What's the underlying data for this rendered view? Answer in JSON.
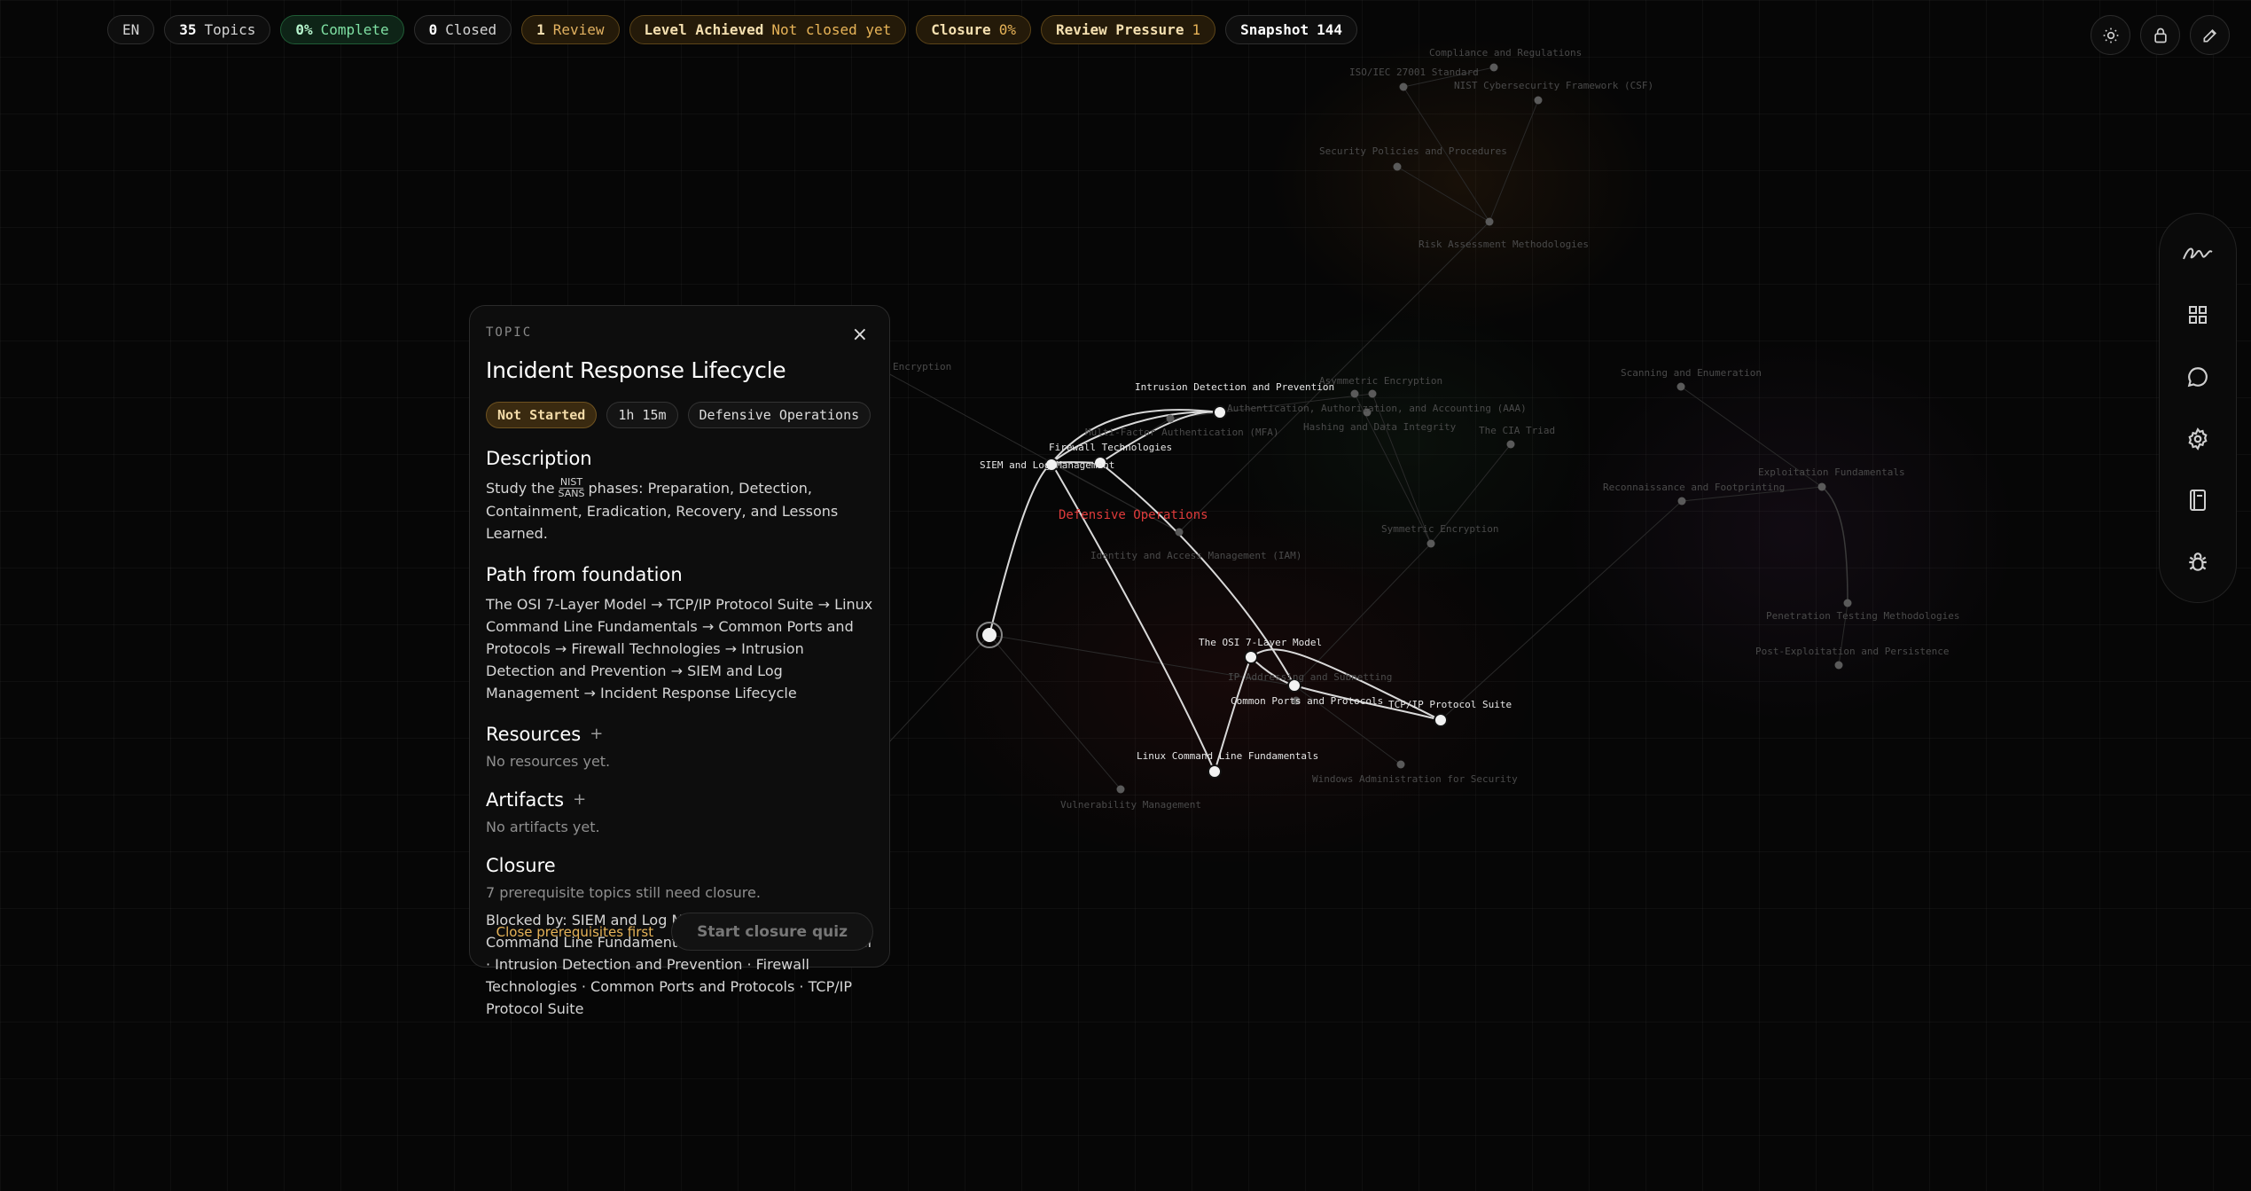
{
  "topbar": {
    "language": "EN",
    "topics_count": "35",
    "topics_label": "Topics",
    "complete_value": "0%",
    "complete_label": "Complete",
    "closed_count": "0",
    "closed_label": "Closed",
    "review_count": "1",
    "review_label": "Review",
    "level_label": "Level Achieved",
    "level_value": "Not closed yet",
    "closure_label": "Closure",
    "closure_value": "0%",
    "pressure_label": "Review Pressure",
    "pressure_value": "1",
    "snapshot_label": "Snapshot",
    "snapshot_value": "144"
  },
  "toolbar_icons": [
    "sun-icon",
    "lock-icon",
    "pencil-icon"
  ],
  "rail_icons": [
    "signature-icon",
    "grid-icon",
    "chat-icon",
    "gear-icon",
    "book-icon",
    "bug-icon"
  ],
  "panel": {
    "eyebrow": "TOPIC",
    "close_glyph": "×",
    "title": "Incident Response Lifecycle",
    "status": "Not Started",
    "duration": "1h 15m",
    "category": "Defensive Operations",
    "description_heading": "Description",
    "description_prefix": "Study the",
    "description_stack_top": "NIST",
    "description_stack_bottom": "SANS",
    "description_suffix": "phases: Preparation, Detection, Containment, Eradication, Recovery, and Lessons Learned.",
    "path_heading": "Path from foundation",
    "path_text": "The OSI 7-Layer Model → TCP/IP Protocol Suite → Linux Command Line Fundamentals → Common Ports and Protocols → Firewall Technologies → Intrusion Detection and Prevention → SIEM and Log Management → Incident Response Lifecycle",
    "resources_heading": "Resources",
    "resources_empty": "No resources yet.",
    "artifacts_heading": "Artifacts",
    "artifacts_empty": "No artifacts yet.",
    "plus_glyph": "+",
    "closure_heading": "Closure",
    "closure_note": "7 prerequisite topics still need closure.",
    "blocked_text": "Blocked by: SIEM and Log Management · Linux Command Line Fundamentals · The OSI 7-Layer Model · Intrusion Detection and Prevention · Firewall Technologies · Common Ports and Protocols · TCP/IP Protocol Suite",
    "close_hint": "Close prerequisites first",
    "quiz_button": "Start closure quiz"
  },
  "graph": {
    "cluster_label": "Defensive Operations",
    "cluster_color": "#e03b3b",
    "active_labels": {
      "ids": "Intrusion Detection and Prevention",
      "firewall": "Firewall Technologies",
      "siem": "SIEM and Log Management",
      "osi": "The OSI 7-Layer Model",
      "ports": "Common Ports and Protocols",
      "tcpip": "TCP/IP Protocol Suite",
      "linux": "Linux Command Line Fundamentals"
    },
    "dim_labels": {
      "compliance": "Compliance and Regulations",
      "iso": "ISO/IEC 27001 Standard",
      "nist": "NIST Cybersecurity Framework (CSF)",
      "policies": "Security Policies and Procedures",
      "risk": "Risk Assessment Methodologies",
      "encryption": "Encryption",
      "asym": "Asymmetric Encryption",
      "aaa": "Authentication, Authorization, and Accounting (AAA)",
      "mfa": "Multi-Factor Authentication (MFA)",
      "hashing": "Hashing and Data Integrity",
      "cia": "The CIA Triad",
      "sym": "Symmetric Encryption",
      "iam": "Identity and Access Management (IAM)",
      "scanning": "Scanning and Enumeration",
      "exploit": "Exploitation Fundamentals",
      "recon": "Reconnaissance and Footprinting",
      "pentest": "Penetration Testing Methodologies",
      "postex": "Post-Exploitation and Persistence",
      "ip": "IP Addressing and Subnetting",
      "windows": "Windows Administration for Security",
      "vuln": "Vulnerability Management"
    }
  }
}
